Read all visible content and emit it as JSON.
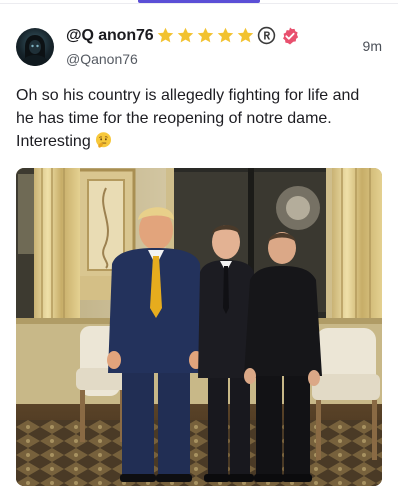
{
  "post": {
    "display_name": "@Q anon76",
    "handle": "@Qanon76",
    "timestamp": "9m",
    "text": "Oh so his country is allegedly fighting for life and he has time for the reopening of notre dame. Interesting",
    "star_badge_count": 5,
    "badges": [
      "star-icon",
      "star-icon",
      "star-icon",
      "star-icon",
      "star-icon",
      "registered-icon",
      "verified-icon"
    ],
    "text_emoji": "thinking-face-emoji",
    "media": {
      "type": "photo",
      "icon": "photo-image"
    }
  },
  "colors": {
    "accent": "#5b4fd6",
    "star": "#f2c230",
    "verified": "#e8506e",
    "handle_text": "#555a62"
  }
}
